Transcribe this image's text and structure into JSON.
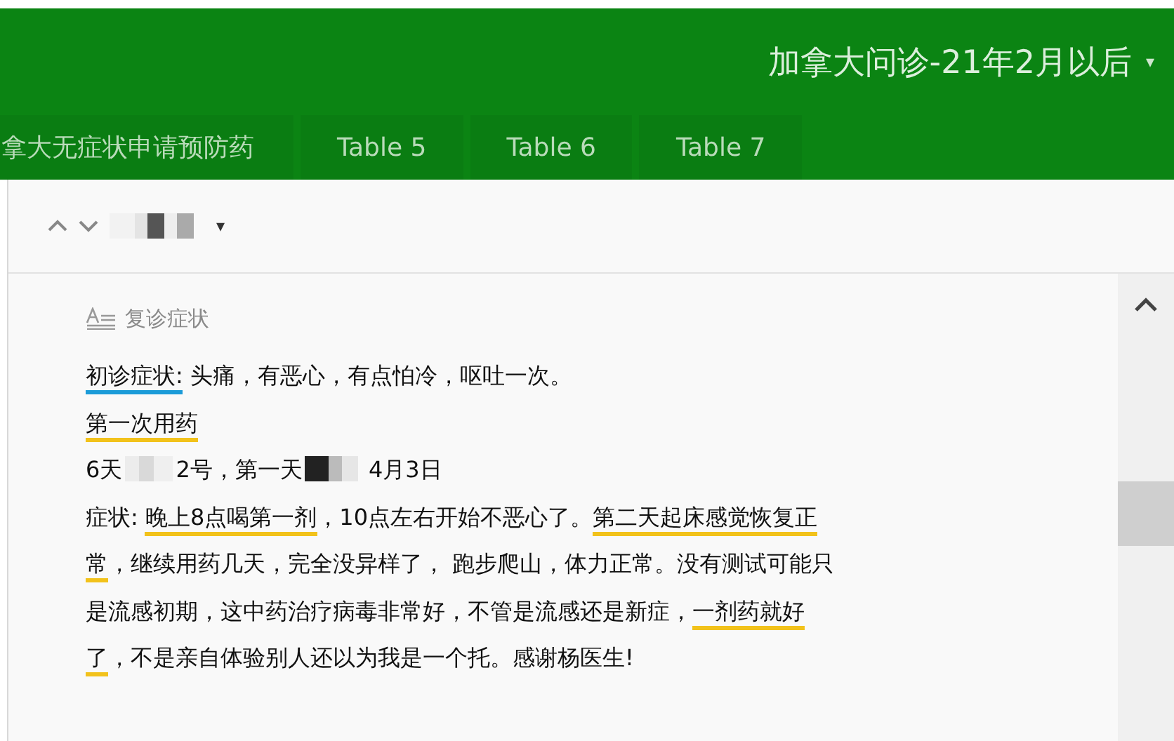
{
  "header": {
    "title": "加拿大问诊-21年2月以后",
    "caret": "▾"
  },
  "tabs": [
    {
      "label": "拿大无症状申请预防药"
    },
    {
      "label": "Table 5"
    },
    {
      "label": "Table 6"
    },
    {
      "label": "Table 7"
    }
  ],
  "toolbar": {
    "caret": "▾"
  },
  "section": {
    "title": "复诊症状"
  },
  "lines": [
    [
      {
        "kind": "text",
        "text": "初诊症状:",
        "color": "#1b9bd8"
      },
      {
        "kind": "text",
        "text": " 头痛，有恶心，有点怕冷，呕吐一次。"
      }
    ],
    [
      {
        "kind": "text",
        "text": "第一次用药",
        "color": "#f2c21b"
      }
    ],
    [
      {
        "kind": "text",
        "text": "6天"
      },
      {
        "kind": "redacted"
      },
      {
        "kind": "text",
        "text": "2号，第一天"
      },
      {
        "kind": "redacted"
      },
      {
        "kind": "text",
        "text": " 4月3日"
      }
    ],
    [
      {
        "kind": "text",
        "text": "症状: "
      },
      {
        "kind": "text",
        "text": "晚上8点喝第一剂",
        "color": "#f2c21b"
      },
      {
        "kind": "text",
        "text": "，10点左右开始不恶心了。"
      },
      {
        "kind": "text",
        "text": "第二天起床感觉恢复正",
        "color": "#f2c21b"
      }
    ],
    [
      {
        "kind": "text",
        "text": "常",
        "color": "#f2c21b"
      },
      {
        "kind": "text",
        "text": "，继续用药几天，完全没异样了， 跑步爬山，体力正常。没有测试可能只"
      }
    ],
    [
      {
        "kind": "text",
        "text": "是流感初期，这中药治疗病毒非常好，不管是流感还是新症，"
      },
      {
        "kind": "text",
        "text": "一剂药就好",
        "color": "#f2c21b"
      }
    ],
    [
      {
        "kind": "text",
        "text": "了",
        "color": "#f2c21b"
      },
      {
        "kind": "text",
        "text": "，不是亲自体验别人还以为我是一个托。感谢杨医生!"
      }
    ]
  ]
}
